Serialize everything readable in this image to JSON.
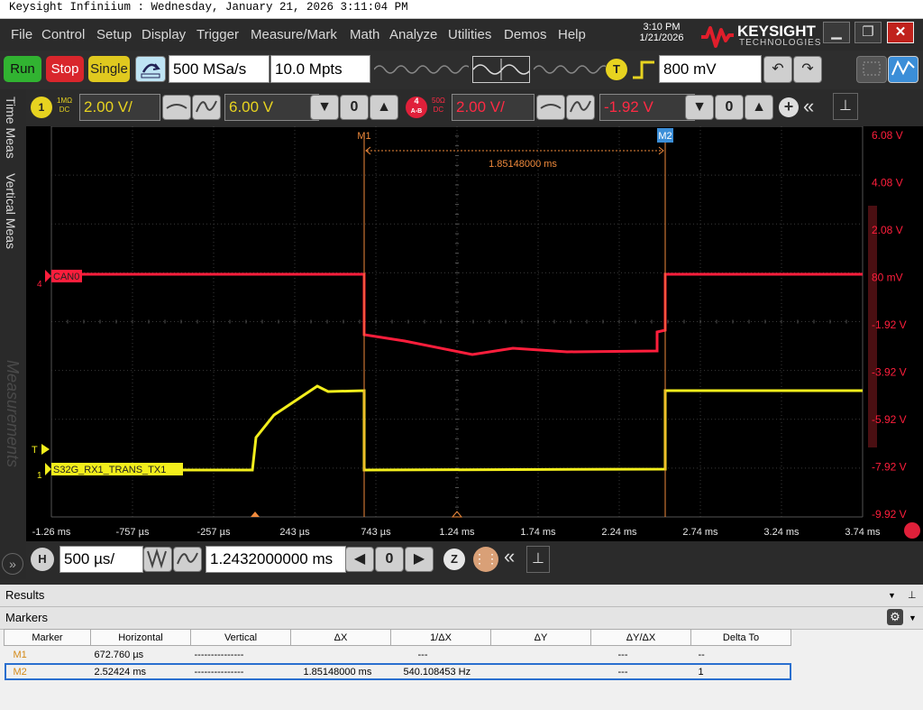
{
  "window": {
    "title": "Keysight Infiniium : Wednesday, January 21, 2026 3:11:04 PM"
  },
  "menu": [
    "File",
    "Control",
    "Setup",
    "Display",
    "Trigger",
    "Measure/Mark",
    "Math",
    "Analyze",
    "Utilities",
    "Demos",
    "Help"
  ],
  "clock": {
    "time": "3:10 PM",
    "date": "1/21/2026"
  },
  "brand": {
    "name": "KEYSIGHT",
    "sub": "TECHNOLOGIES"
  },
  "toolbar": {
    "run": "Run",
    "stop": "Stop",
    "single": "Single",
    "sample_rate": "500 MSa/s",
    "memory_depth": "10.0 Mpts",
    "trigger_label": "T",
    "trigger_level": "800 mV"
  },
  "channel1": {
    "number": "1",
    "impedance": "1MΩ",
    "coupling": "DC",
    "scale": "2.00 V/",
    "offset": "6.00 V"
  },
  "channel4": {
    "number": "4",
    "sub": "A-B",
    "impedance": "50Ω",
    "coupling": "DC",
    "scale": "2.00 V/",
    "offset": "-1.92 V"
  },
  "sidebar": {
    "tab1": "Time Meas",
    "tab2": "Vertical Meas",
    "watermark": "Measurements"
  },
  "plot": {
    "ch4_label": "CAN0",
    "ch1_label": "S32G_RX1_TRANS_TX1",
    "marker1": "M1",
    "marker2": "M2",
    "delta": "1.85148000 ms",
    "trigger_marker": "T",
    "ch4_ground": "4",
    "ch1_ground": "1",
    "right_axis": [
      "6.08 V",
      "4.08 V",
      "2.08 V",
      "80 mV",
      "-1.92 V",
      "-3.92 V",
      "-5.92 V",
      "-7.92 V",
      "-9.92 V"
    ],
    "time_axis": [
      "-1.26 ms",
      "-757 µs",
      "-257 µs",
      "243 µs",
      "743 µs",
      "1.24 ms",
      "1.74 ms",
      "2.24 ms",
      "2.74 ms",
      "3.24 ms",
      "3.74 ms"
    ]
  },
  "colors": {
    "ch1": "#f2ee1c",
    "ch4": "#ff1e3c",
    "marker": "#f08a3c"
  },
  "horizontal": {
    "label": "H",
    "scale": "500 µs/",
    "position": "1.2432000000 ms"
  },
  "results": {
    "title": "Results",
    "panel": "Markers",
    "columns": [
      "Marker",
      "Horizontal",
      "Vertical",
      "ΔX",
      "1/ΔX",
      "ΔY",
      "ΔY/ΔX",
      "Delta To"
    ],
    "rows": [
      [
        "M1",
        "672.760 µs",
        "---------------",
        "",
        "---",
        "",
        "---",
        "--"
      ],
      [
        "M2",
        "2.52424 ms",
        "---------------",
        "1.85148000 ms",
        "540.108453 Hz",
        "",
        "---",
        "1"
      ]
    ]
  }
}
